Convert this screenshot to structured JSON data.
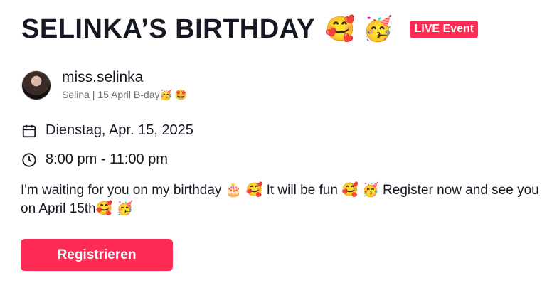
{
  "event": {
    "title": "SELINKA’S BIRTHDAY",
    "title_emojis": "🥰 🥳",
    "badge": "LIVE Event"
  },
  "host": {
    "name": "miss.selinka",
    "subtitle": "Selina | 15 April B-day🥳 🤩"
  },
  "details": {
    "date": "Dienstag, Apr. 15, 2025",
    "time": "8:00 pm - 11:00 pm",
    "date_icon": "calendar-icon",
    "time_icon": "clock-icon"
  },
  "description": "I'm waiting for you on my birthday 🎂 🥰 It will be fun 🥰 🥳 Register now and see you on April 15th🥰 🥳",
  "actions": {
    "register_label": "Registrieren"
  },
  "colors": {
    "accent": "#fe2c55",
    "text": "#161823",
    "muted": "#6b6d75"
  }
}
